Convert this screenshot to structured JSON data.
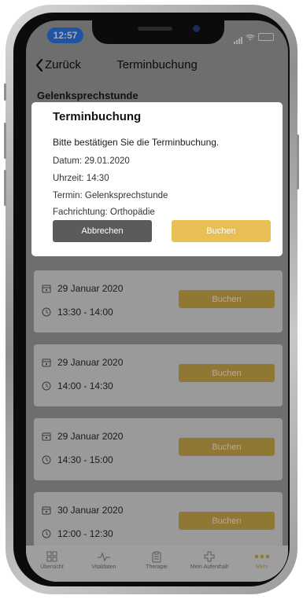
{
  "status_bar": {
    "time": "12:57"
  },
  "header": {
    "back_label": "Zurück",
    "title": "Terminbuchung"
  },
  "section_title": "Gelenksprechstunde",
  "slots": [
    {
      "date": "29 Januar 2020",
      "time": "13:30 - 14:00",
      "button": "Buchen"
    },
    {
      "date": "29 Januar 2020",
      "time": "14:00 - 14:30",
      "button": "Buchen"
    },
    {
      "date": "29 Januar 2020",
      "time": "14:30 - 15:00",
      "button": "Buchen"
    },
    {
      "date": "30 Januar 2020",
      "time": "12:00 - 12:30",
      "button": "Buchen"
    }
  ],
  "modal": {
    "title": "Terminbuchung",
    "message": "Bitte bestätigen Sie die Terminbuchung.",
    "details": {
      "date": "Datum: 29.01.2020",
      "time": "Uhrzeit: 14:30",
      "appointment": "Termin: Gelenksprechstunde",
      "specialty": "Fachrichtung: Orthopädie"
    },
    "cancel_label": "Abbrechen",
    "confirm_label": "Buchen"
  },
  "tabbar": {
    "items": [
      {
        "label": "Übersicht",
        "icon": "grid-icon"
      },
      {
        "label": "Vitaldaten",
        "icon": "pulse-icon"
      },
      {
        "label": "Therapie",
        "icon": "clipboard-icon"
      },
      {
        "label": "Mein Aufenthalt",
        "icon": "cross-icon"
      },
      {
        "label": "Mehr",
        "icon": "more-icon"
      }
    ],
    "active_index": 4
  },
  "colors": {
    "accent": "#e8bf54",
    "accent_dimmed": "#d9b24e",
    "cancel": "#5b5b5b",
    "time_pill": "#2f7cf6"
  }
}
